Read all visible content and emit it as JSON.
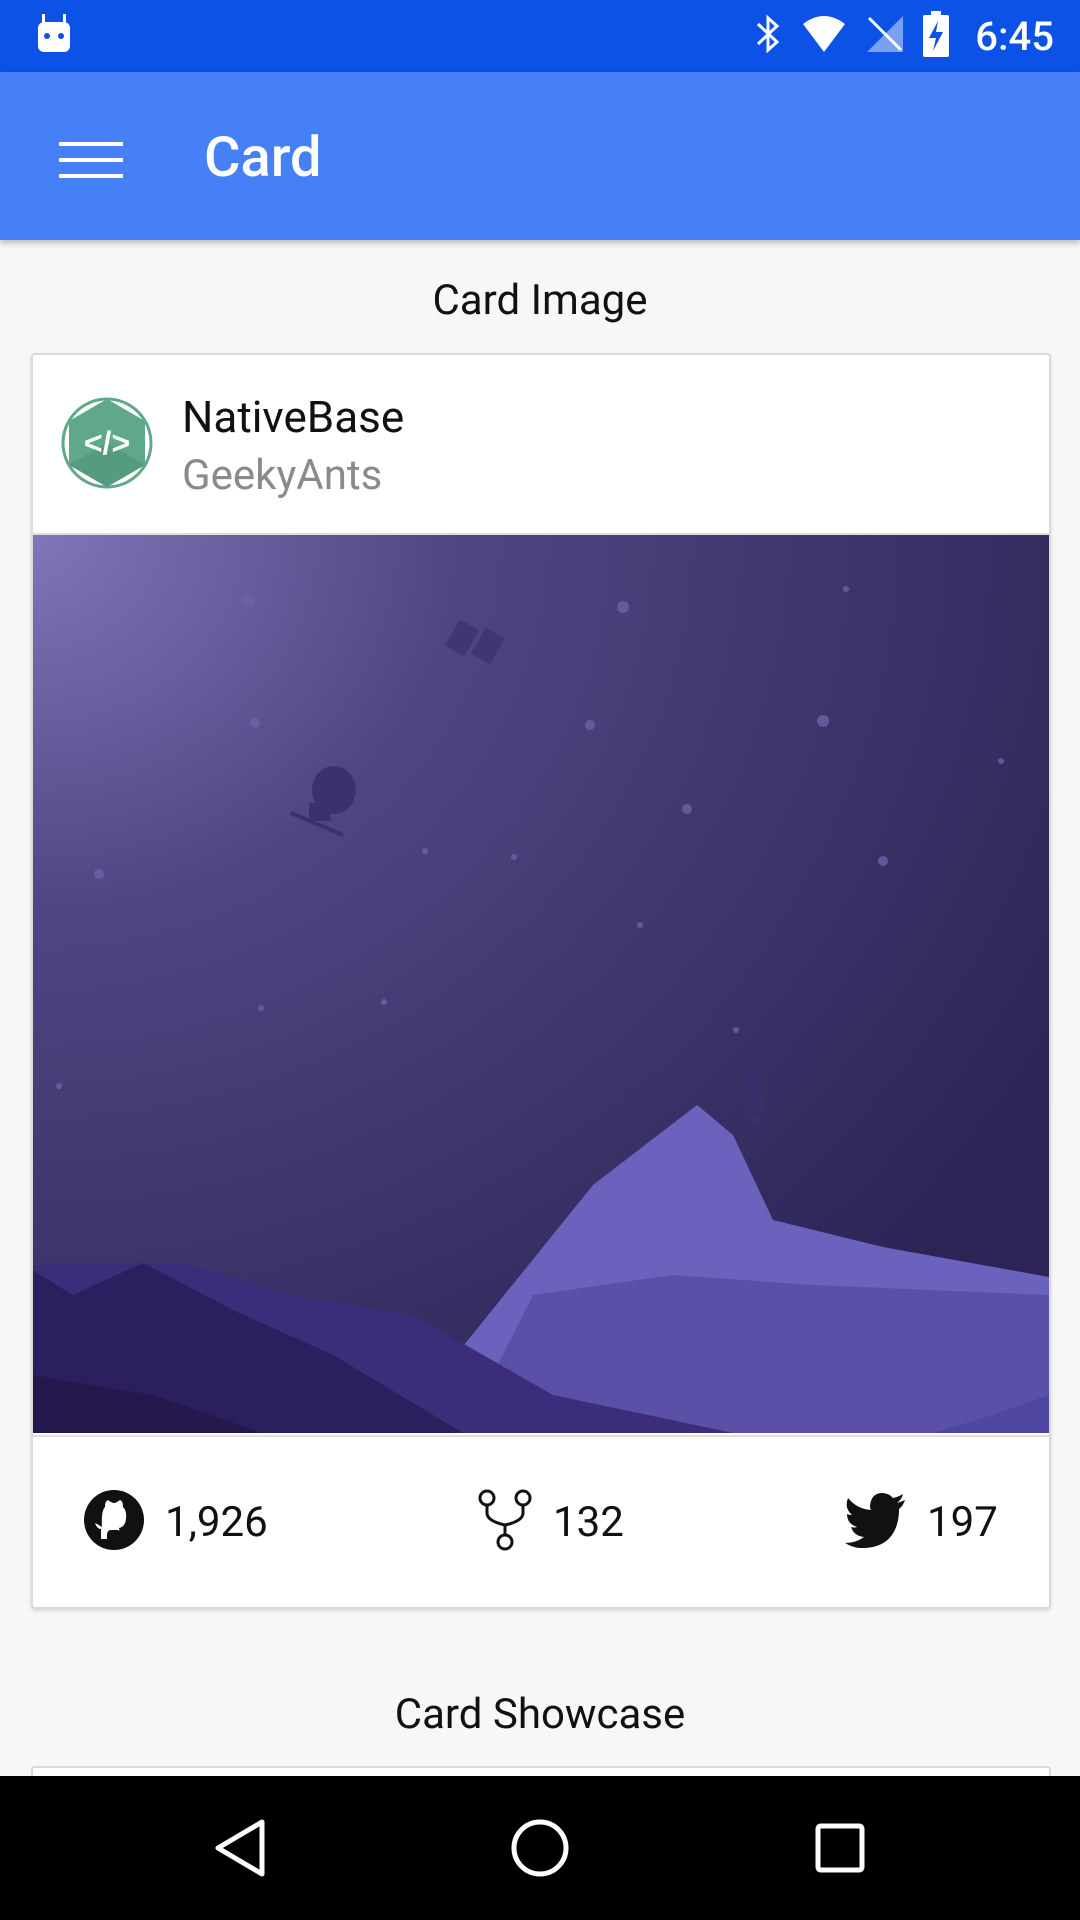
{
  "status_bar": {
    "time": "6:45",
    "icons": [
      "android-icon",
      "bluetooth-icon",
      "wifi-icon",
      "no-signal-icon",
      "battery-charging-icon"
    ]
  },
  "app_bar": {
    "title": "Card",
    "menu_icon": "hamburger-menu-icon",
    "color": "#4680f6"
  },
  "sections": {
    "card_image_title": "Card Image",
    "card_showcase_title": "Card Showcase"
  },
  "card": {
    "header": {
      "title": "NativeBase",
      "subtitle": "GeekyAnts",
      "avatar_icon": "code-brackets-logo-icon",
      "avatar_color": "#5fa88a"
    },
    "image": {
      "description_icon": "space-mountain-illustration"
    },
    "footer": {
      "github": {
        "icon": "github-icon",
        "value": "1,926"
      },
      "forks": {
        "icon": "fork-icon",
        "value": "132"
      },
      "twitter": {
        "icon": "twitter-icon",
        "value": "197"
      }
    }
  },
  "nav_bar": {
    "back_icon": "back-triangle-icon",
    "home_icon": "home-circle-icon",
    "recents_icon": "recents-square-icon"
  }
}
